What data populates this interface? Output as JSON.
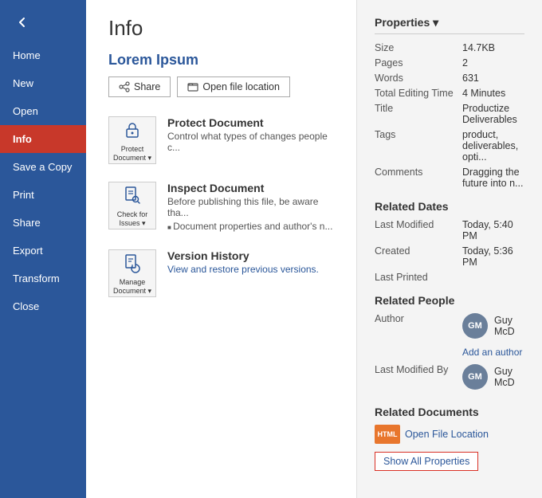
{
  "sidebar": {
    "back_icon": "←",
    "items": [
      {
        "id": "home",
        "label": "Home",
        "active": false
      },
      {
        "id": "new",
        "label": "New",
        "active": false
      },
      {
        "id": "open",
        "label": "Open",
        "active": false
      },
      {
        "id": "info",
        "label": "Info",
        "active": true
      },
      {
        "id": "save-copy",
        "label": "Save a Copy",
        "active": false
      },
      {
        "id": "print",
        "label": "Print",
        "active": false
      },
      {
        "id": "share",
        "label": "Share",
        "active": false
      },
      {
        "id": "export",
        "label": "Export",
        "active": false
      },
      {
        "id": "transform",
        "label": "Transform",
        "active": false
      },
      {
        "id": "close",
        "label": "Close",
        "active": false
      }
    ]
  },
  "page": {
    "title": "Info",
    "doc_title": "Lorem Ipsum",
    "share_label": "Share",
    "open_file_location_label": "Open file location"
  },
  "protect_document": {
    "icon_label": "Protect\nDocument",
    "title": "Protect Document",
    "subtitle": "Control what types of changes people c...",
    "dropdown": "Protect Document▾"
  },
  "inspect_document": {
    "icon_label": "Check for\nIssues",
    "title": "Inspect Document",
    "subtitle": "Before publishing this file, be aware tha...",
    "bullet": "Document properties and author's n..."
  },
  "version_history": {
    "icon_label": "Manage\nDocument",
    "title": "Version History",
    "link_label": "View and restore previous versions.",
    "dropdown": "Manage Document▾"
  },
  "properties": {
    "section_title": "Properties ▾",
    "rows": [
      {
        "label": "Size",
        "value": "14.7KB"
      },
      {
        "label": "Pages",
        "value": "2"
      },
      {
        "label": "Words",
        "value": "631"
      },
      {
        "label": "Total Editing Time",
        "value": "4 Minutes"
      },
      {
        "label": "Title",
        "value": "Productize Deliverables"
      },
      {
        "label": "Tags",
        "value": "product, deliverables, opti..."
      },
      {
        "label": "Comments",
        "value": "Dragging the future into n..."
      }
    ]
  },
  "related_dates": {
    "section_title": "Related Dates",
    "rows": [
      {
        "label": "Last Modified",
        "value": "Today, 5:40 PM"
      },
      {
        "label": "Created",
        "value": "Today, 5:36 PM"
      },
      {
        "label": "Last Printed",
        "value": ""
      }
    ]
  },
  "related_people": {
    "section_title": "Related People",
    "author_label": "Author",
    "author_avatar": "GM",
    "author_name": "Guy McD",
    "add_author_label": "Add an author",
    "last_modified_label": "Last Modified By",
    "modifier_avatar": "GM",
    "modifier_name": "Guy McD"
  },
  "related_documents": {
    "section_title": "Related Documents",
    "open_file_label": "Open File Location",
    "show_all_label": "Show All Properties"
  }
}
